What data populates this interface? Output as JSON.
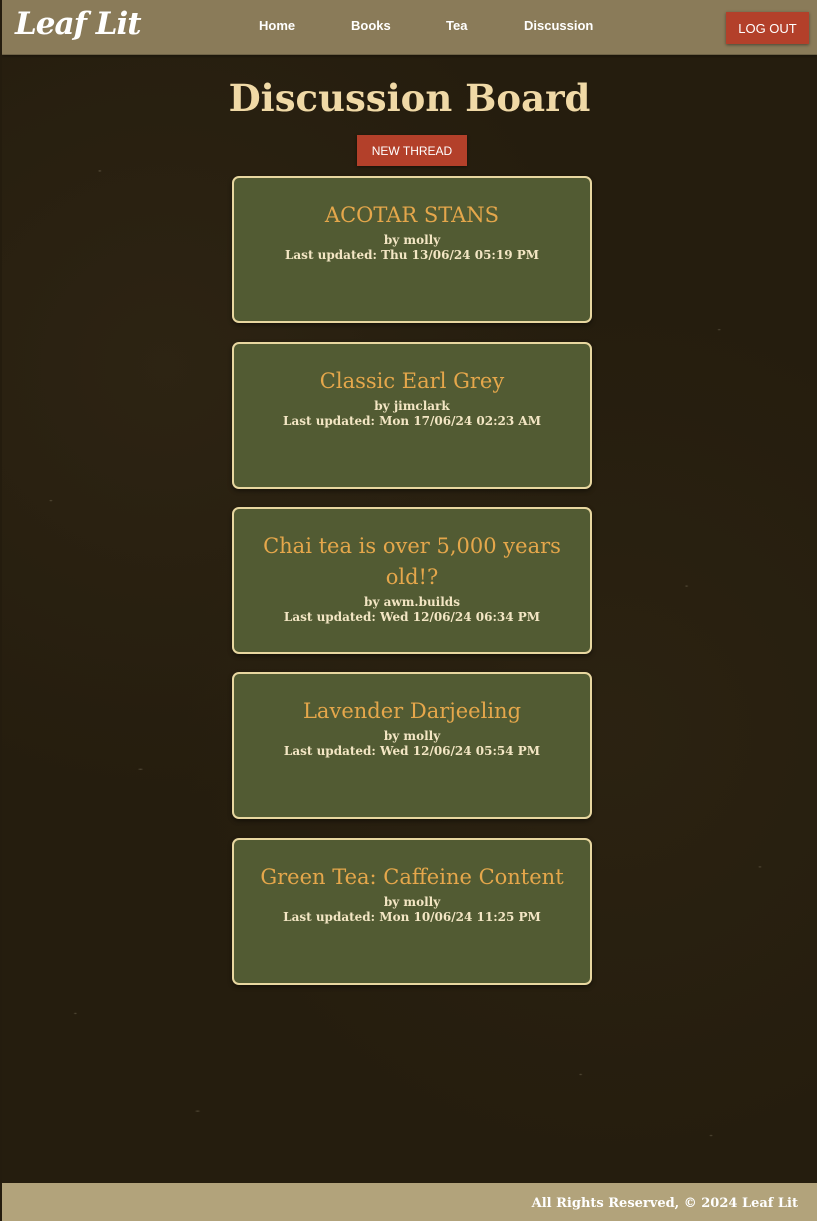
{
  "brand": {
    "name": "Leaf Lit"
  },
  "nav": {
    "items": [
      {
        "label": "Home"
      },
      {
        "label": "Books"
      },
      {
        "label": "Tea"
      },
      {
        "label": "Discussion"
      }
    ],
    "logout_label": "LOG OUT"
  },
  "main": {
    "title": "Discussion Board",
    "new_thread_label": "NEW THREAD",
    "threads": [
      {
        "title": "ACOTAR STANS",
        "author": "by molly",
        "updated": "Last updated: Thu 13/06/24 05:19 PM"
      },
      {
        "title": "Classic Earl Grey",
        "author": "by jimclark",
        "updated": "Last updated: Mon 17/06/24 02:23 AM"
      },
      {
        "title": "Chai tea is over 5,000 years old!?",
        "author": "by awm.builds",
        "updated": "Last updated: Wed 12/06/24 06:34 PM"
      },
      {
        "title": "Lavender Darjeeling",
        "author": "by molly",
        "updated": "Last updated: Wed 12/06/24 05:54 PM"
      },
      {
        "title": "Green Tea: Caffeine Content",
        "author": "by molly",
        "updated": "Last updated: Mon 10/06/24 11:25 PM"
      }
    ]
  },
  "footer": {
    "text": "All Rights Reserved, © 2024 Leaf Lit"
  },
  "colors": {
    "background": "#251d0e",
    "navbar": "#8a7b59",
    "button": "#b3402a",
    "card": "#525b33",
    "card_border": "#e8d7a0",
    "card_title": "#e5a74b",
    "page_title": "#f0d9a6",
    "footer": "#b2a37b"
  }
}
